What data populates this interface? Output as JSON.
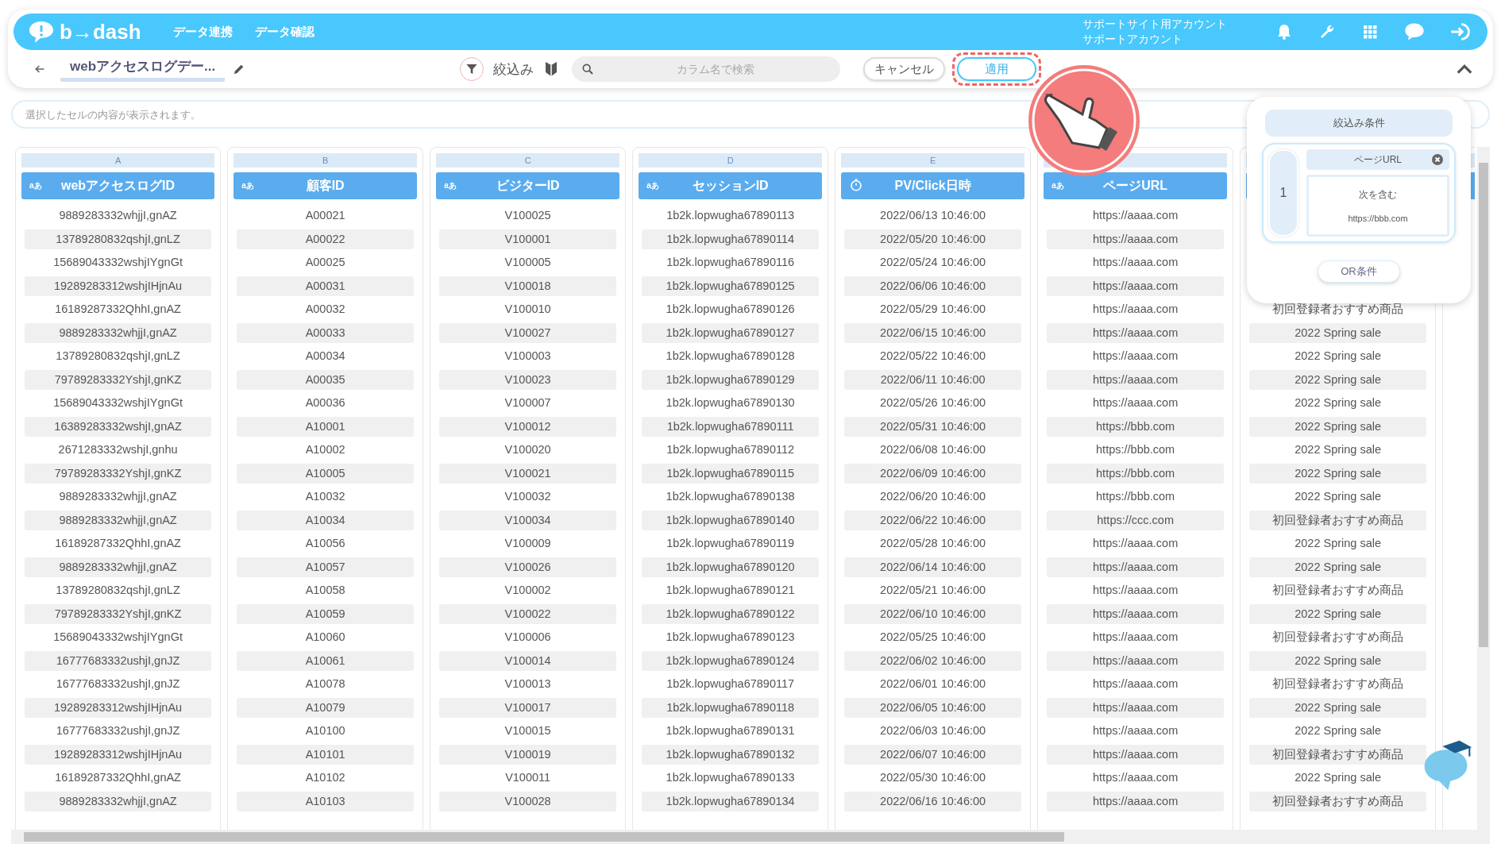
{
  "header": {
    "logo": "b→dash",
    "nav": [
      "データ連携",
      "データ確認"
    ],
    "account": {
      "line1": "サポートサイト用アカウント",
      "line2": "サポートアカウント"
    }
  },
  "toolbar": {
    "title": "webアクセスログデー...",
    "filter_label": "絞込み",
    "search": {
      "placeholder": "カラム名で検索"
    },
    "buttons": [
      {
        "kind": "cancel",
        "label": "キャンセル",
        "highlighted": false
      },
      {
        "kind": "apply",
        "label": "適用",
        "highlighted": true
      }
    ]
  },
  "cell_view": {
    "placeholder": "選択したセルの内容が表示されます。"
  },
  "columns": [
    {
      "letter": "A",
      "kind": "text",
      "type_label": "aあ",
      "title": "webアクセスログID",
      "cells": [
        "9889283332whjjI,gnAZ",
        "13789280832qshjI,gnLZ",
        "15689043332wshjIYgnGt",
        "19289283312wshjIHjnAu",
        "16189287332QhhI,gnAZ",
        "9889283332whjjI,gnAZ",
        "13789280832qshjI,gnLZ",
        "79789283332YshjI,gnKZ",
        "15689043332wshjIYgnGt",
        "16389283332wshjI,gnAZ",
        "2671283332wshjI,gnhu",
        "79789283332YshjI,gnKZ",
        "9889283332whjjI,gnAZ",
        "9889283332whjjI,gnAZ",
        "16189287332QhhI,gnAZ",
        "9889283332whjjI,gnAZ",
        "13789280832qshjI,gnLZ",
        "79789283332YshjI,gnKZ",
        "15689043332wshjIYgnGt",
        "16777683332ushjI,gnJZ",
        "16777683332ushjI,gnJZ",
        "19289283312wshjIHjnAu",
        "16777683332ushjI,gnJZ",
        "19289283312wshjIHjnAu",
        "16189287332QhhI,gnAZ",
        "9889283332whjjI,gnAZ"
      ]
    },
    {
      "letter": "B",
      "kind": "text",
      "type_label": "aあ",
      "title": "顧客ID",
      "cells": [
        "A00021",
        "A00022",
        "A00025",
        "A00031",
        "A00032",
        "A00033",
        "A00034",
        "A00035",
        "A00036",
        "A10001",
        "A10002",
        "A10005",
        "A10032",
        "A10034",
        "A10056",
        "A10057",
        "A10058",
        "A10059",
        "A10060",
        "A10061",
        "A10078",
        "A10079",
        "A10100",
        "A10101",
        "A10102",
        "A10103"
      ]
    },
    {
      "letter": "C",
      "kind": "text",
      "type_label": "aあ",
      "title": "ビジターID",
      "cells": [
        "V100025",
        "V100001",
        "V100005",
        "V100018",
        "V100010",
        "V100027",
        "V100003",
        "V100023",
        "V100007",
        "V100012",
        "V100020",
        "V100021",
        "V100032",
        "V100034",
        "V100009",
        "V100026",
        "V100002",
        "V100022",
        "V100006",
        "V100014",
        "V100013",
        "V100017",
        "V100015",
        "V100019",
        "V100011",
        "V100028"
      ]
    },
    {
      "letter": "D",
      "kind": "text",
      "type_label": "aあ",
      "title": "セッションID",
      "cells": [
        "1b2k.lopwugha67890113",
        "1b2k.lopwugha67890114",
        "1b2k.lopwugha67890116",
        "1b2k.lopwugha67890125",
        "1b2k.lopwugha67890126",
        "1b2k.lopwugha67890127",
        "1b2k.lopwugha67890128",
        "1b2k.lopwugha67890129",
        "1b2k.lopwugha67890130",
        "1b2k.lopwugha67890111",
        "1b2k.lopwugha67890112",
        "1b2k.lopwugha67890115",
        "1b2k.lopwugha67890138",
        "1b2k.lopwugha67890140",
        "1b2k.lopwugha67890119",
        "1b2k.lopwugha67890120",
        "1b2k.lopwugha67890121",
        "1b2k.lopwugha67890122",
        "1b2k.lopwugha67890123",
        "1b2k.lopwugha67890124",
        "1b2k.lopwugha67890117",
        "1b2k.lopwugha67890118",
        "1b2k.lopwugha67890131",
        "1b2k.lopwugha67890132",
        "1b2k.lopwugha67890133",
        "1b2k.lopwugha67890134"
      ]
    },
    {
      "letter": "E",
      "kind": "datetime",
      "title": "PV/Click日時",
      "cells": [
        "2022/06/13 10:46:00",
        "2022/05/20 10:46:00",
        "2022/05/24 10:46:00",
        "2022/06/06 10:46:00",
        "2022/05/29 10:46:00",
        "2022/06/15 10:46:00",
        "2022/05/22 10:46:00",
        "2022/06/11 10:46:00",
        "2022/05/26 10:46:00",
        "2022/05/31 10:46:00",
        "2022/06/08 10:46:00",
        "2022/06/09 10:46:00",
        "2022/06/20 10:46:00",
        "2022/06/22 10:46:00",
        "2022/05/28 10:46:00",
        "2022/06/14 10:46:00",
        "2022/05/21 10:46:00",
        "2022/06/10 10:46:00",
        "2022/05/25 10:46:00",
        "2022/06/02 10:46:00",
        "2022/06/01 10:46:00",
        "2022/06/05 10:46:00",
        "2022/06/03 10:46:00",
        "2022/06/07 10:46:00",
        "2022/05/30 10:46:00",
        "2022/06/16 10:46:00"
      ]
    },
    {
      "kind": "text",
      "type_label": "aあ",
      "title": "ページURL",
      "cells": [
        "https://aaaa.com",
        "https://aaaa.com",
        "https://aaaa.com",
        "https://aaaa.com",
        "https://aaaa.com",
        "https://aaaa.com",
        "https://aaaa.com",
        "https://aaaa.com",
        "https://aaaa.com",
        "https://bbb.com",
        "https://bbb.com",
        "https://bbb.com",
        "https://bbb.com",
        "https://ccc.com",
        "https://aaaa.com",
        "https://aaaa.com",
        "https://aaaa.com",
        "https://aaaa.com",
        "https://aaaa.com",
        "https://aaaa.com",
        "https://aaaa.com",
        "https://aaaa.com",
        "https://aaaa.com",
        "https://aaaa.com",
        "https://aaaa.com",
        "https://aaaa.com"
      ]
    },
    {
      "kind": "text",
      "cells": [
        "初回登録者おすすめ商品",
        "2022 Spring sale",
        "2022 Spring sale",
        "2022 Spring sale",
        "2022 Spring sale",
        "2022 Spring sale",
        "2022 Spring sale",
        "2022 Spring sale",
        "2022 Spring sale",
        "初回登録者おすすめ商品",
        "2022 Spring sale",
        "2022 Spring sale",
        "初回登録者おすすめ商品",
        "2022 Spring sale",
        "初回登録者おすすめ商品",
        "2022 Spring sale",
        "初回登録者おすすめ商品",
        "2022 Spring sale",
        "2022 Spring sale",
        "初回登録者おすすめ商品",
        "2022 Spring sale",
        "初回登録者おすすめ商品"
      ]
    }
  ],
  "filter_popup": {
    "title": "絞込み条件",
    "groups": [
      {
        "number": "1",
        "column": "ページURL",
        "operator": "次を含む",
        "value": "https://bbb.com"
      }
    ],
    "or_button": "OR条件"
  }
}
